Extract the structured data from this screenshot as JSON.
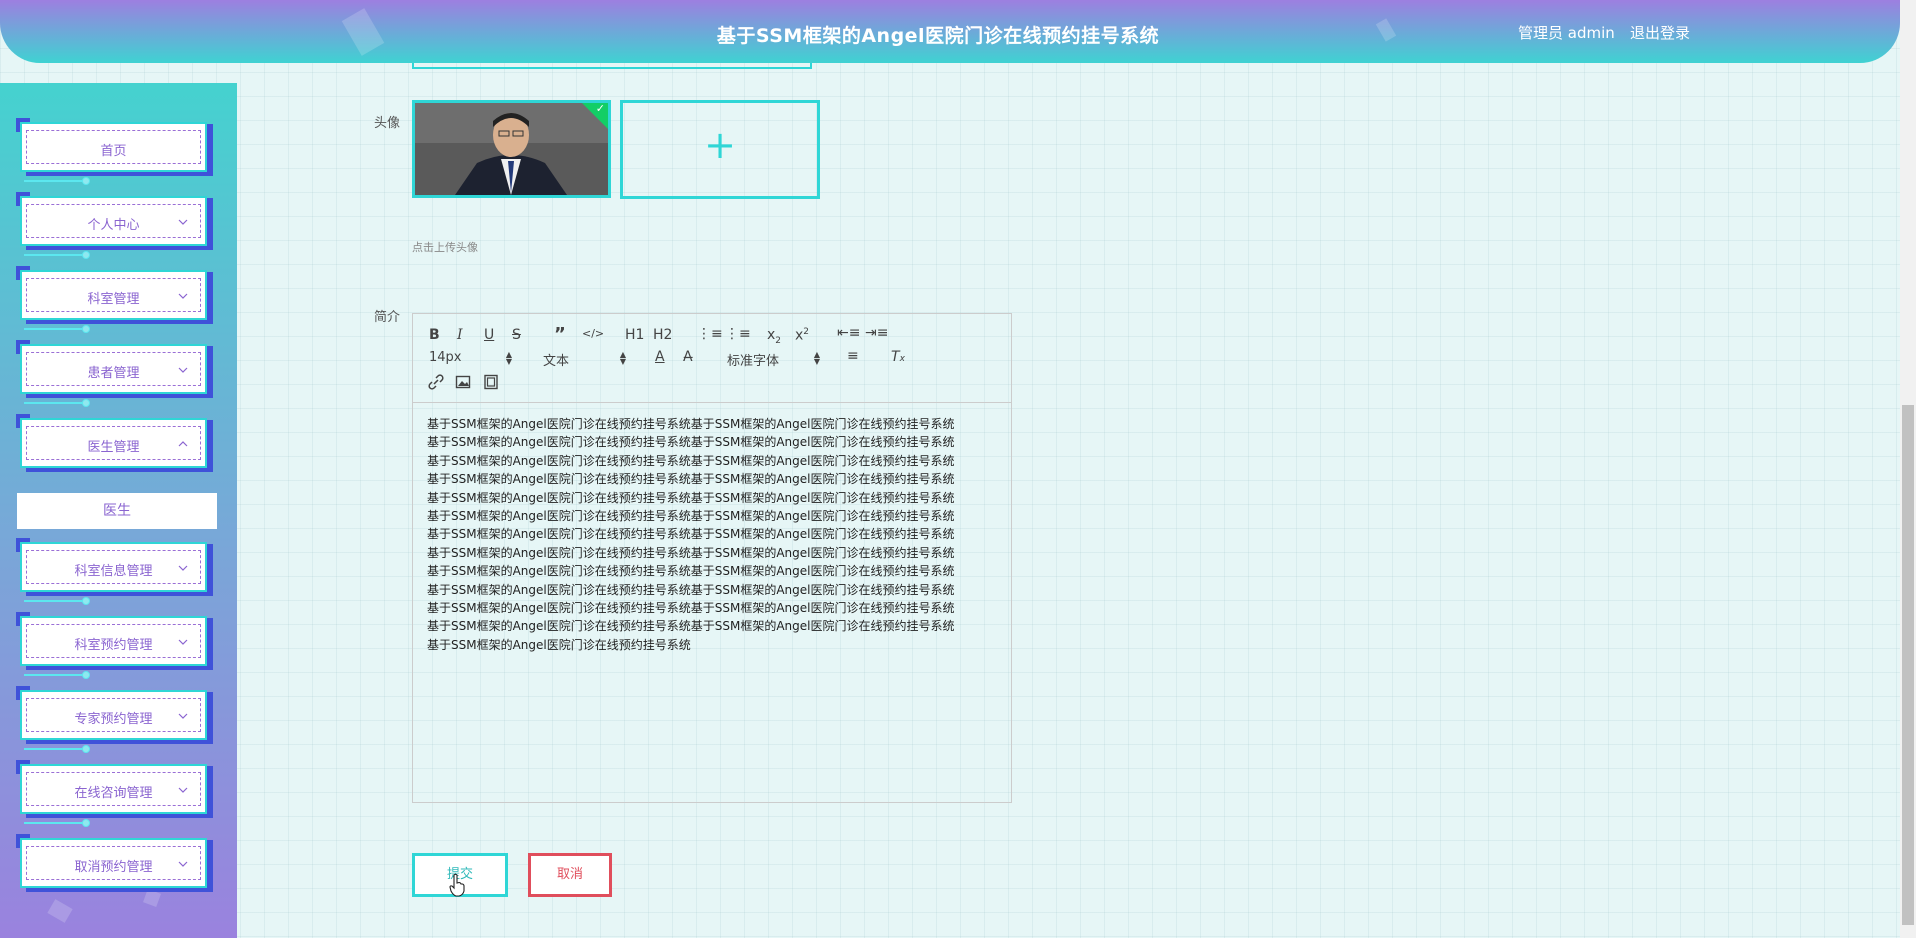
{
  "header": {
    "title": "基于SSM框架的Angel医院门诊在线预约挂号系统",
    "user": "管理员 admin",
    "logout": "退出登录"
  },
  "sidebar": {
    "items": [
      {
        "label": "首页",
        "has_chevron": false
      },
      {
        "label": "个人中心",
        "has_chevron": true,
        "chevron": "chevron-down"
      },
      {
        "label": "科室管理",
        "has_chevron": true,
        "chevron": "chevron-down"
      },
      {
        "label": "患者管理",
        "has_chevron": true,
        "chevron": "chevron-down"
      },
      {
        "label": "医生管理",
        "has_chevron": true,
        "chevron": "chevron-up"
      },
      {
        "label": "科室信息管理",
        "has_chevron": true,
        "chevron": "chevron-down"
      },
      {
        "label": "科室预约管理",
        "has_chevron": true,
        "chevron": "chevron-down"
      },
      {
        "label": "专家预约管理",
        "has_chevron": true,
        "chevron": "chevron-down"
      },
      {
        "label": "在线咨询管理",
        "has_chevron": true,
        "chevron": "chevron-down"
      },
      {
        "label": "取消预约管理",
        "has_chevron": true,
        "chevron": "chevron-down"
      }
    ],
    "submenu": {
      "label": "医生"
    }
  },
  "form": {
    "avatar_label": "头像",
    "upload_tip": "点击上传头像",
    "intro_label": "简介",
    "editor": {
      "font_size": "14px",
      "format": "文本",
      "font_family": "标准字体",
      "h1": "H1",
      "h2": "H2",
      "content_lines": [
        "基于SSM框架的Angel医院门诊在线预约挂号系统基于SSM框架的Angel医院门诊在线预约挂号系统",
        "基于SSM框架的Angel医院门诊在线预约挂号系统基于SSM框架的Angel医院门诊在线预约挂号系统",
        "基于SSM框架的Angel医院门诊在线预约挂号系统基于SSM框架的Angel医院门诊在线预约挂号系统",
        "基于SSM框架的Angel医院门诊在线预约挂号系统基于SSM框架的Angel医院门诊在线预约挂号系统",
        "基于SSM框架的Angel医院门诊在线预约挂号系统基于SSM框架的Angel医院门诊在线预约挂号系统",
        "基于SSM框架的Angel医院门诊在线预约挂号系统基于SSM框架的Angel医院门诊在线预约挂号系统",
        "基于SSM框架的Angel医院门诊在线预约挂号系统基于SSM框架的Angel医院门诊在线预约挂号系统",
        "基于SSM框架的Angel医院门诊在线预约挂号系统基于SSM框架的Angel医院门诊在线预约挂号系统",
        "基于SSM框架的Angel医院门诊在线预约挂号系统基于SSM框架的Angel医院门诊在线预约挂号系统",
        "基于SSM框架的Angel医院门诊在线预约挂号系统基于SSM框架的Angel医院门诊在线预约挂号系统",
        "基于SSM框架的Angel医院门诊在线预约挂号系统基于SSM框架的Angel医院门诊在线预约挂号系统",
        "基于SSM框架的Angel医院门诊在线预约挂号系统基于SSM框架的Angel医院门诊在线预约挂号系统",
        "基于SSM框架的Angel医院门诊在线预约挂号系统"
      ]
    },
    "submit": "提交",
    "cancel": "取消"
  },
  "colors": {
    "accent": "#2fd6d6",
    "purple": "#8a64d0",
    "danger": "#e04e5c"
  }
}
